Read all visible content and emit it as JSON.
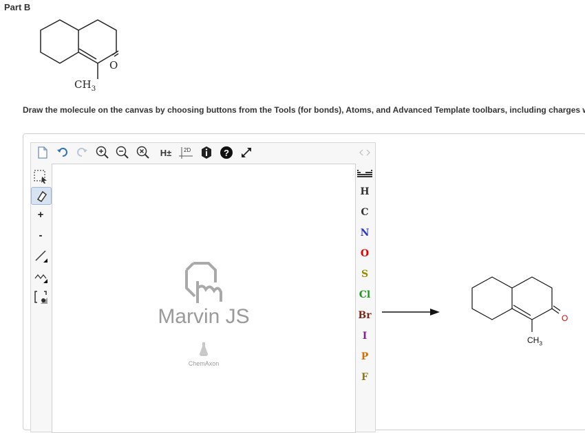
{
  "part_title": "Part B",
  "question_molecule": {
    "substituent_label": "CH3",
    "oxygen_label": "O"
  },
  "instructions": "Draw the molecule on the canvas by choosing buttons from the Tools (for bonds), Atoms, and Advanced Template toolbars, including charges where needed. The single bond is active by default.",
  "top_toolbar": {
    "h_toggle_label": "H±",
    "clean2d_label": "2D"
  },
  "left_toolbar": {
    "plus_label": "+",
    "minus_label": "-"
  },
  "atoms": [
    "H",
    "C",
    "N",
    "O",
    "S",
    "Cl",
    "Br",
    "I",
    "P",
    "F"
  ],
  "atom_colors": {
    "H": "#333333",
    "C": "#333333",
    "N": "#2a35c8",
    "O": "#e00000",
    "S": "#9a8a00",
    "Cl": "#1c9a1c",
    "Br": "#7a2a1a",
    "I": "#8a1a9a",
    "P": "#d07000",
    "F": "#8a7a1a"
  },
  "canvas": {
    "watermark_title": "Marvin JS",
    "watermark_brand": "ChemAxon"
  },
  "answer_molecule": {
    "substituent_label": "CH3",
    "oxygen_label": "O"
  }
}
